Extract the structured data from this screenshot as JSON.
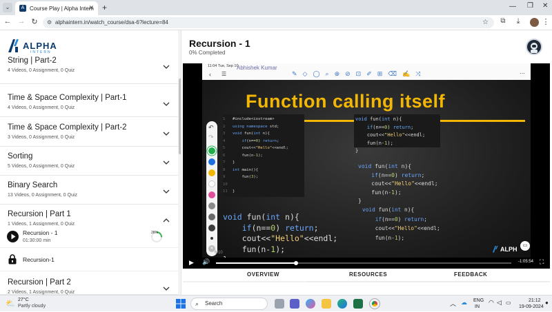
{
  "browser": {
    "tab_title": "Course Play | Alpha Intern",
    "url": "alphaintern.in/watch_course/dsa-6?lecture=84",
    "new_tab_symbol": "+"
  },
  "brand": {
    "name": "ALPHA",
    "tagline": "INTERN",
    "color": "#0d3a6e",
    "accent": "#2a8bd8"
  },
  "sidebar": {
    "sections": [
      {
        "title": "String | Part-2",
        "meta": "4 Videos, 0 Assignment, 0 Quiz",
        "expanded": false
      },
      {
        "title": "Time & Space Complexity | Part-1",
        "meta": "4 Videos, 0 Assignment, 0 Quiz",
        "expanded": false
      },
      {
        "title": "Time & Space Complexity | Part-2",
        "meta": "3 Videos, 0 Assignment, 0 Quiz",
        "expanded": false
      },
      {
        "title": "Sorting",
        "meta": "5 Videos, 0 Assignment, 0 Quiz",
        "expanded": false
      },
      {
        "title": "Binary Search",
        "meta": "13 Videos, 0 Assignment, 0 Quiz",
        "expanded": false
      },
      {
        "title": "Recursion | Part 1",
        "meta": "1 Videos, 1 Assignment, 0 Quiz",
        "expanded": true
      },
      {
        "title": "Recursion | Part 2",
        "meta": "2 Videos, 1 Assignment, 0 Quiz",
        "expanded": false
      }
    ],
    "lessons": [
      {
        "title": "Recursion - 1",
        "duration": "01:30:00 min",
        "progress_label": "26%",
        "progress": 0.26
      },
      {
        "title": "Recursion-1"
      }
    ]
  },
  "main": {
    "lecture_title": "Recursion - 1",
    "progress_text": "0% Completed"
  },
  "video": {
    "notes_time": "11:04  Tue, Sep 10",
    "presenter": "Abhishek Kumar",
    "slide_title": "Function calling itself",
    "code_small": [
      "#include<iostream>",
      "using namespace std;",
      "void fun(int n){",
      "    if(n==0) return;",
      "    cout<<\"Hello\"<<endl;",
      "    fun(n-1);",
      "}",
      "int main(){",
      "    fun(3);",
      "",
      "}"
    ],
    "code_small_lines": [
      "1",
      "2",
      "3",
      "4",
      "5",
      "6",
      "7",
      "8",
      "9",
      "10",
      "11"
    ],
    "code_big": [
      "void fun(int n){",
      "    if(n==0) return;",
      "    cout<<\"Hello\"<<endl;",
      "    fun(n-1);",
      "}"
    ],
    "code_right1": [
      "void fun(int n){",
      "    if(n==0) return;",
      "    cout<<\"Hello\"<<endl;",
      "    fun(n-1);",
      "}"
    ],
    "code_right2": [
      "void fun(int n){",
      "    if(n==0) return;",
      "    cout<<\"Hello\"<<endl;",
      "    fun(n-1);",
      "}"
    ],
    "code_right3": [
      "void fun(int n){",
      "    if(n==0) return;",
      "    cout<<\"Hello\"<<endl;",
      "    fun(n-1);"
    ],
    "page_indicator": "6/10",
    "watermark": "ALPH",
    "time_remaining": "-1:05:54",
    "played_fraction": 0.27,
    "palette_colors": [
      "#1fb04b",
      "#1e6fe0",
      "#f2b705",
      "#ffffff",
      "#e0509a",
      "#8a8a8a",
      "#6a6a6a",
      "#3d3d3d"
    ]
  },
  "tabs": [
    "OVERVIEW",
    "RESOURCES",
    "FEEDBACK"
  ],
  "taskbar": {
    "temperature": "27°C",
    "weather": "Partly cloudy",
    "search_placeholder": "Search",
    "lang1": "ENG",
    "lang2": "IN",
    "time": "21:12",
    "date": "19-09-2024"
  }
}
